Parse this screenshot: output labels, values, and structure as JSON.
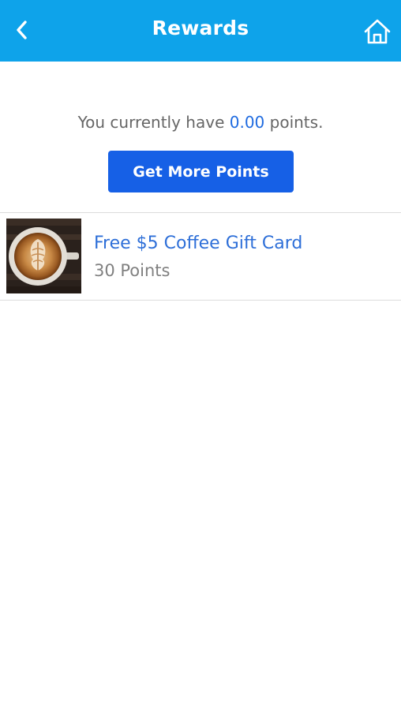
{
  "header": {
    "title": "Rewards",
    "back_icon": "chevron-left-icon",
    "home_icon": "home-icon",
    "background": "#0ea3ea"
  },
  "summary": {
    "prefix": "You currently have ",
    "points": "0.00",
    "suffix": " points.",
    "button_label": "Get More Points",
    "accent": "#1660e6"
  },
  "rewards": [
    {
      "name": "Free $5 Coffee Gift Card",
      "points": "30 Points",
      "image": "latte-art-coffee-cup"
    }
  ]
}
